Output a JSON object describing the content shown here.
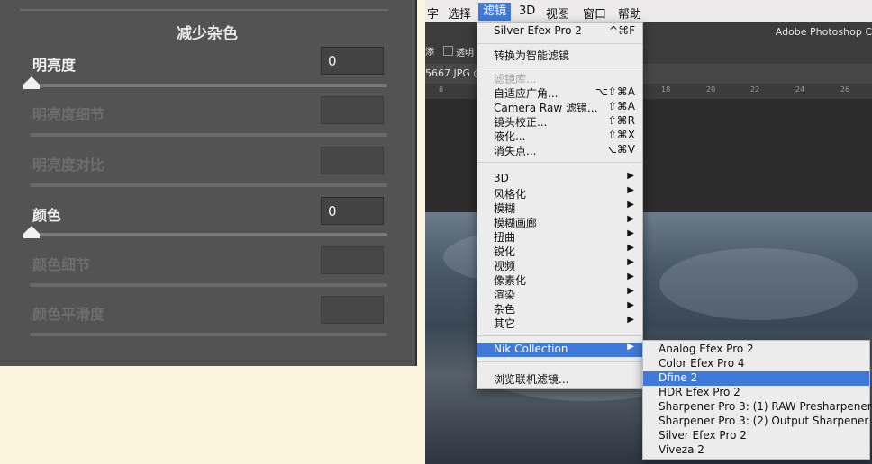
{
  "left_panel": {
    "title": "减少杂色",
    "rows": [
      {
        "label": "明亮度",
        "value": "0",
        "enabled": true
      },
      {
        "label": "明亮度细节",
        "value": "",
        "enabled": false
      },
      {
        "label": "明亮度对比",
        "value": "",
        "enabled": false
      },
      {
        "label": "颜色",
        "value": "0",
        "enabled": true
      },
      {
        "label": "颜色细节",
        "value": "",
        "enabled": false
      },
      {
        "label": "颜色平滑度",
        "value": "",
        "enabled": false
      }
    ]
  },
  "menubar": {
    "items": [
      "字",
      "选择",
      "滤镜",
      "3D",
      "视图",
      "窗口",
      "帮助"
    ],
    "active": "滤镜"
  },
  "app_title": "Adobe Photoshop C",
  "options_bar": {
    "transparent_label": "透明",
    "left_fragment": "添"
  },
  "document_tab": "5667.JPG @",
  "ruler_ticks": [
    "8",
    "18",
    "20",
    "22",
    "24",
    "26"
  ],
  "filter_menu": {
    "items": [
      {
        "label": "Silver Efex Pro 2",
        "shortcut": "^⌘F"
      },
      {
        "label": "转换为智能滤镜",
        "shortcut": ""
      },
      {
        "label": "滤镜库...",
        "shortcut": "",
        "disabled": true
      },
      {
        "label": "自适应广角...",
        "shortcut": "⌥⇧⌘A"
      },
      {
        "label": "Camera Raw 滤镜...",
        "shortcut": "⇧⌘A"
      },
      {
        "label": "镜头校正...",
        "shortcut": "⇧⌘R"
      },
      {
        "label": "液化...",
        "shortcut": "⇧⌘X"
      },
      {
        "label": "消失点...",
        "shortcut": "⌥⌘V"
      },
      {
        "label": "3D",
        "submenu": true
      },
      {
        "label": "风格化",
        "submenu": true
      },
      {
        "label": "模糊",
        "submenu": true
      },
      {
        "label": "模糊画廊",
        "submenu": true
      },
      {
        "label": "扭曲",
        "submenu": true
      },
      {
        "label": "锐化",
        "submenu": true
      },
      {
        "label": "视频",
        "submenu": true
      },
      {
        "label": "像素化",
        "submenu": true
      },
      {
        "label": "渲染",
        "submenu": true
      },
      {
        "label": "杂色",
        "submenu": true
      },
      {
        "label": "其它",
        "submenu": true
      },
      {
        "label": "Nik Collection",
        "submenu": true,
        "highlighted": true
      },
      {
        "label": "浏览联机滤镜...",
        "shortcut": ""
      }
    ]
  },
  "nik_submenu": {
    "items": [
      "Analog Efex Pro 2",
      "Color Efex Pro 4",
      "Dfine 2",
      "HDR Efex Pro 2",
      "Sharpener Pro 3: (1) RAW Presharpener",
      "Sharpener Pro 3: (2) Output Sharpener",
      "Silver Efex Pro 2",
      "Viveza 2"
    ],
    "highlighted": "Dfine 2"
  },
  "icons": {
    "submenu_arrow": "▶",
    "slider_thumb": "triangle-slider-thumb"
  },
  "colors": {
    "highlight": "#3f7ad8",
    "panel_bg": "#535353",
    "background": "#fbf4dc"
  }
}
